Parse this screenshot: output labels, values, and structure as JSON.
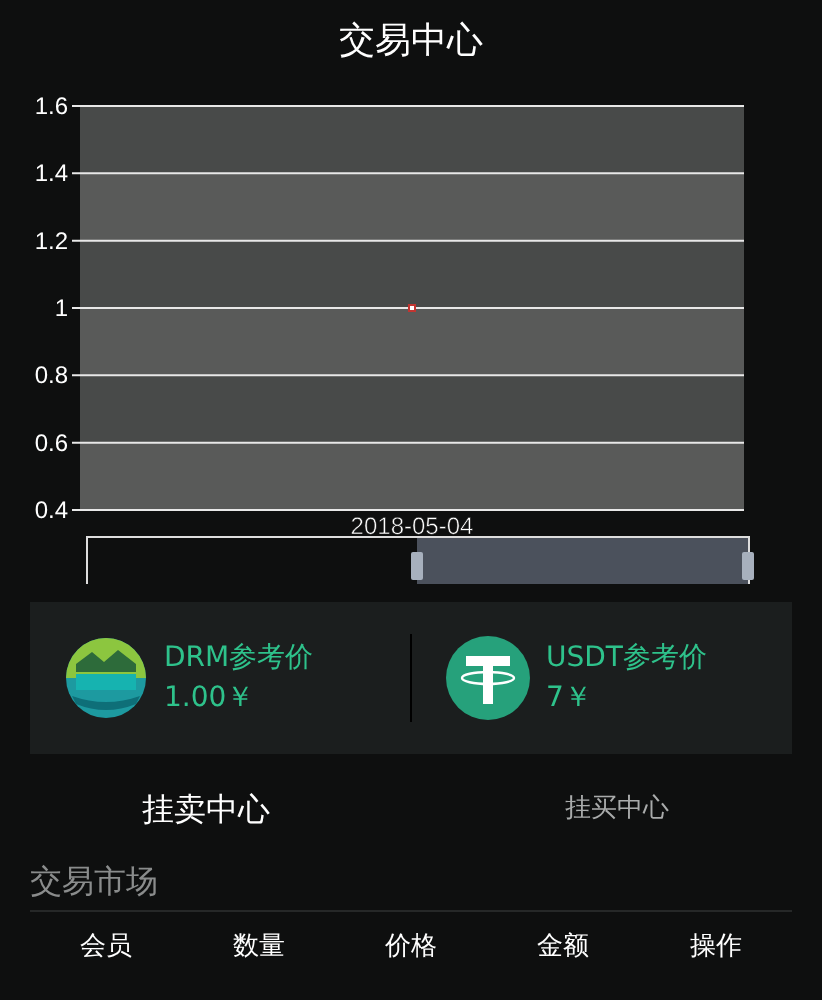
{
  "title": "交易中心",
  "chart": {
    "chart_data": {
      "type": "line",
      "grid": true,
      "categories": [
        "2018-05-04"
      ],
      "series": [
        {
          "color": "#c23531",
          "marker": true,
          "values": [
            1
          ]
        }
      ],
      "ylim": [
        0.4,
        1.6
      ],
      "yticks": [
        0.4,
        0.6,
        0.8,
        1,
        1.2,
        1.4,
        1.6
      ]
    }
  },
  "prices": [
    {
      "kind": "drm",
      "label": "DRM参考价",
      "value": "1.00￥"
    },
    {
      "kind": "usdt",
      "label": "USDT参考价",
      "value": "7￥"
    }
  ],
  "tabs": [
    {
      "label": "挂卖中心",
      "selected": true
    },
    {
      "label": "挂买中心",
      "selected": false
    }
  ],
  "market": {
    "title": "交易市场",
    "columns": [
      "会员",
      "数量",
      "价格",
      "金额",
      "操作"
    ]
  }
}
